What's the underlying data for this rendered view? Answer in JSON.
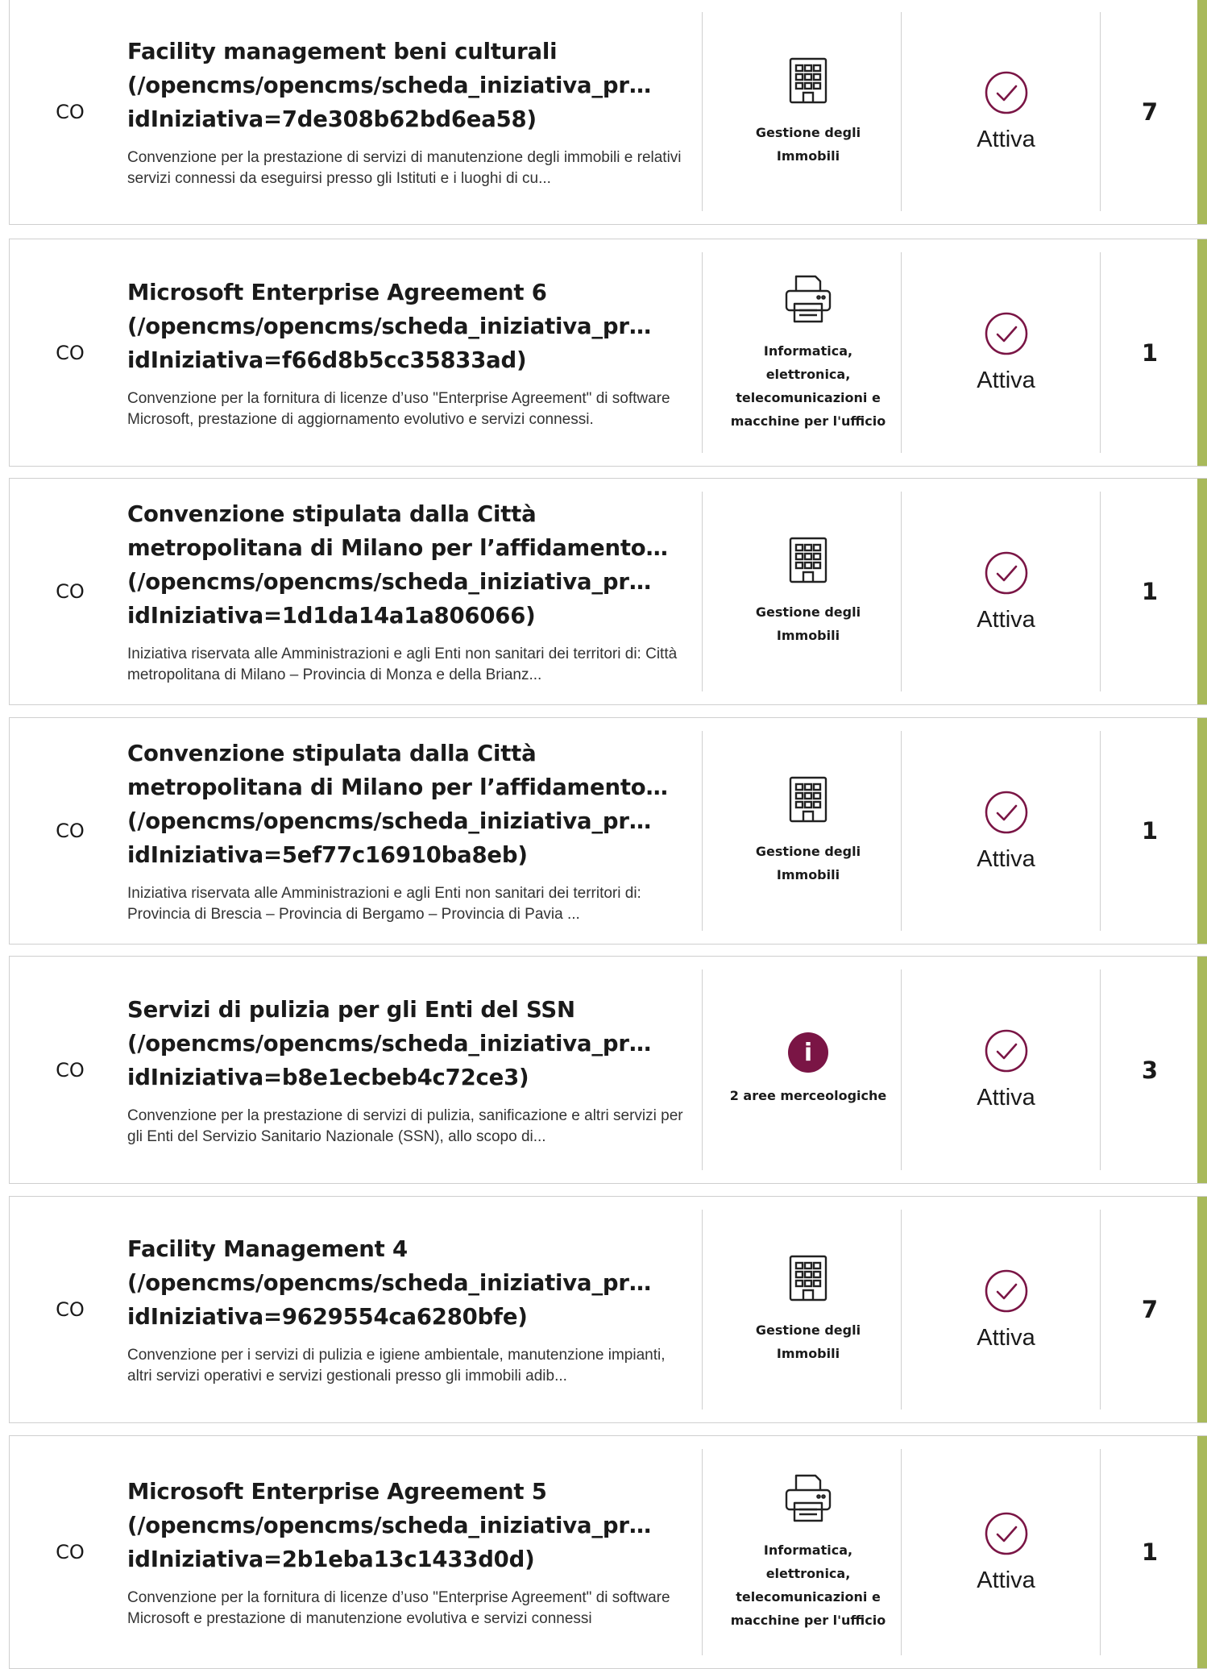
{
  "colors": {
    "accent_bar": "#a8b95a",
    "status_icon": "#7a1545",
    "info_icon": "#7a1545"
  },
  "rows": [
    {
      "type": "CO",
      "title_lines": [
        "Facility management beni culturali",
        "(/opencms/opencms/scheda_iniziativa_pr…",
        "idIniziativa=7de308b62bd6ea58)"
      ],
      "description": "Convenzione per la prestazione di servizi di manutenzione degli immobili e relativi servizi connessi da eseguirsi presso gli Istituti e i luoghi di cu...",
      "category_icon": "building-icon",
      "category_lines": [
        "Gestione degli",
        "Immobili"
      ],
      "status": "Attiva",
      "count": "7"
    },
    {
      "type": "CO",
      "title_lines": [
        "Microsoft Enterprise Agreement 6",
        "(/opencms/opencms/scheda_iniziativa_pr…",
        "idIniziativa=f66d8b5cc35833ad)"
      ],
      "description": "Convenzione per la fornitura di licenze d’uso \"Enterprise Agreement\" di software Microsoft, prestazione di aggiornamento evolutivo e servizi connessi.",
      "category_icon": "printer-icon",
      "category_lines": [
        "Informatica,",
        "elettronica,",
        "telecomunicazioni e",
        "macchine per l'ufficio"
      ],
      "status": "Attiva",
      "count": "1"
    },
    {
      "type": "CO",
      "title_lines": [
        "Convenzione stipulata dalla Città",
        "metropolitana di Milano per l’affidamento…",
        "(/opencms/opencms/scheda_iniziativa_pr…",
        "idIniziativa=1d1da14a1a806066)"
      ],
      "description": "Iniziativa riservata alle Amministrazioni e agli Enti non sanitari dei territori di: Città metropolitana di Milano – Provincia di Monza e della Brianz...",
      "category_icon": "building-icon",
      "category_lines": [
        "Gestione degli",
        "Immobili"
      ],
      "status": "Attiva",
      "count": "1"
    },
    {
      "type": "CO",
      "title_lines": [
        "Convenzione stipulata dalla Città",
        "metropolitana di Milano per l’affidamento…",
        "(/opencms/opencms/scheda_iniziativa_pr…",
        "idIniziativa=5ef77c16910ba8eb)"
      ],
      "description": "Iniziativa riservata alle Amministrazioni e agli Enti non sanitari dei territori di: Provincia di Brescia – Provincia di Bergamo – Provincia di Pavia ...",
      "category_icon": "building-icon",
      "category_lines": [
        "Gestione degli",
        "Immobili"
      ],
      "status": "Attiva",
      "count": "1"
    },
    {
      "type": "CO",
      "title_lines": [
        "Servizi di pulizia per gli Enti del SSN",
        "(/opencms/opencms/scheda_iniziativa_pr…",
        "idIniziativa=b8e1ecbeb4c72ce3)"
      ],
      "description": "Convenzione per la prestazione di servizi di pulizia, sanificazione e altri servizi per gli Enti del Servizio Sanitario Nazionale (SSN), allo scopo di...",
      "category_icon": "info-icon",
      "category_lines": [
        "2 aree merceologiche"
      ],
      "status": "Attiva",
      "count": "3"
    },
    {
      "type": "CO",
      "title_lines": [
        "Facility Management 4",
        "(/opencms/opencms/scheda_iniziativa_pr…",
        "idIniziativa=9629554ca6280bfe)"
      ],
      "description": "Convenzione per i servizi di pulizia e igiene ambientale, manutenzione impianti, altri servizi operativi e servizi gestionali presso gli immobili adib...",
      "category_icon": "building-icon",
      "category_lines": [
        "Gestione degli",
        "Immobili"
      ],
      "status": "Attiva",
      "count": "7"
    },
    {
      "type": "CO",
      "title_lines": [
        "Microsoft Enterprise Agreement 5",
        "(/opencms/opencms/scheda_iniziativa_pr…",
        "idIniziativa=2b1eba13c1433d0d)"
      ],
      "description": "Convenzione per la fornitura di licenze d’uso \"Enterprise Agreement\" di software Microsoft e prestazione di manutenzione evolutiva e servizi connessi",
      "category_icon": "printer-icon",
      "category_lines": [
        "Informatica,",
        "elettronica,",
        "telecomunicazioni e",
        "macchine per l'ufficio"
      ],
      "status": "Attiva",
      "count": "1"
    }
  ]
}
